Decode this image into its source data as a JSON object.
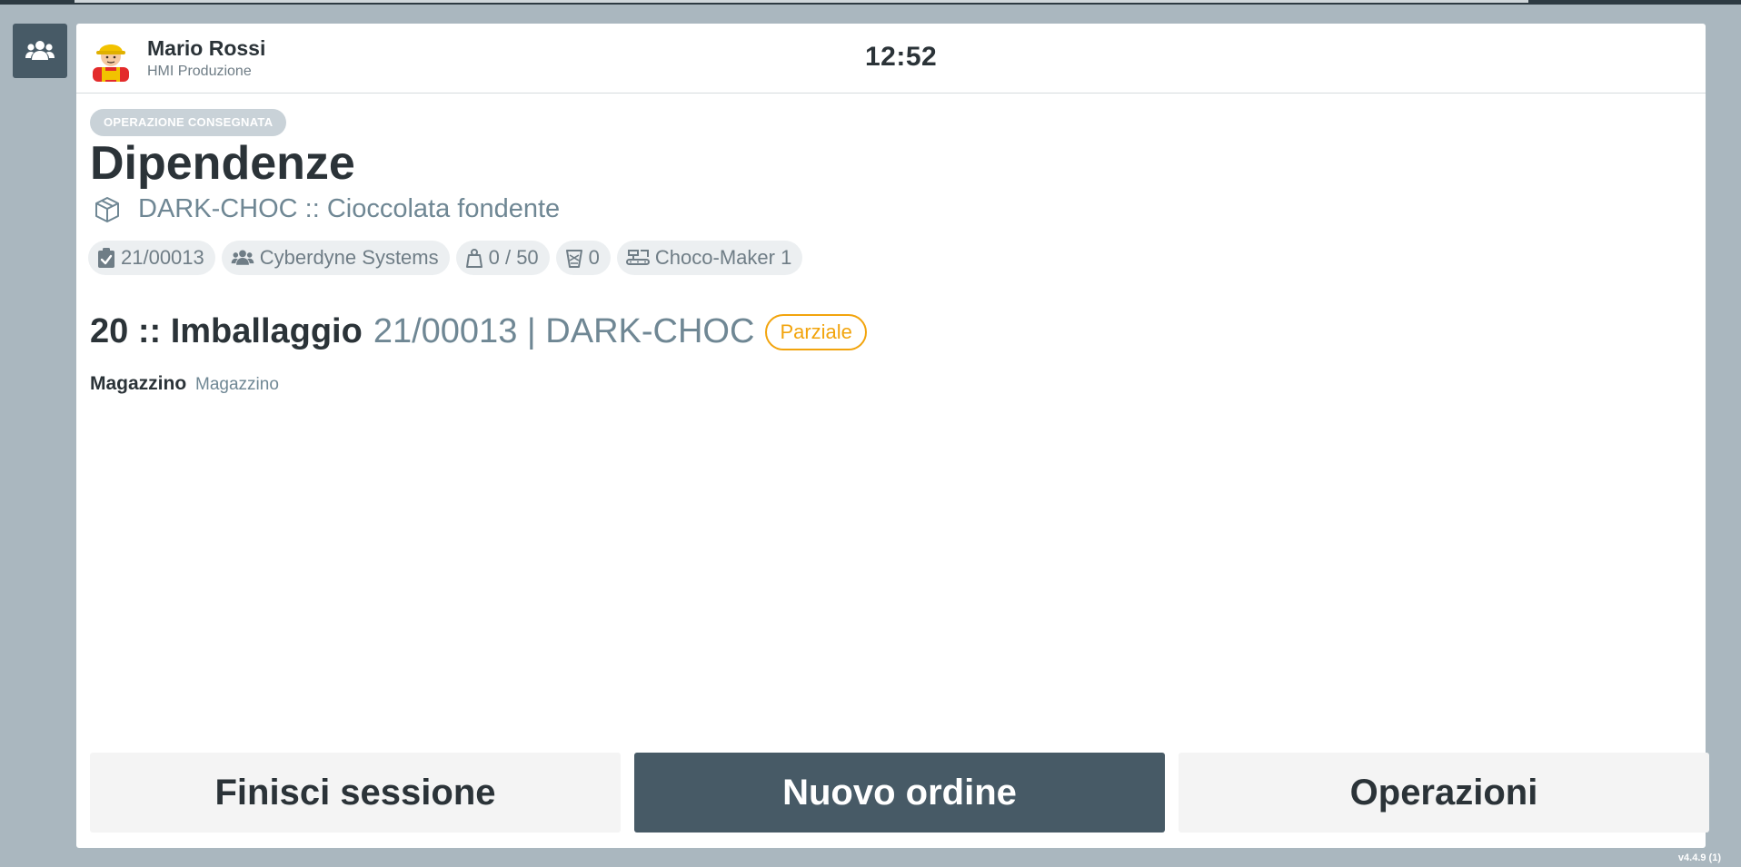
{
  "sidebar": {
    "icon": "users-icon"
  },
  "user": {
    "name": "Mario Rossi",
    "role": "HMI Produzione",
    "avatar_icon": "worker-avatar-icon"
  },
  "clock": "12:52",
  "status": "OPERAZIONE CONSEGNATA",
  "title": "Dipendenze",
  "product": {
    "icon": "box-icon",
    "label": "DARK-CHOC :: Cioccolata fondente"
  },
  "chips": {
    "order": {
      "icon": "clipboard-check-icon",
      "label": "21/00013"
    },
    "customer": {
      "icon": "users-icon",
      "label": "Cyberdyne Systems"
    },
    "quantity": {
      "icon": "weight-icon",
      "label": "0 / 50"
    },
    "waste": {
      "icon": "trash-icon",
      "label": "0"
    },
    "machine": {
      "icon": "machine-icon",
      "label": "Choco-Maker 1"
    }
  },
  "operation": {
    "title": "20 :: Imballaggio",
    "subtitle": "21/00013 | DARK-CHOC",
    "badge": "Parziale",
    "badge_color": "#f2a40d"
  },
  "warehouse": {
    "label": "Magazzino",
    "value": "Magazzino"
  },
  "actions": {
    "end_session": "Finisci sessione",
    "new_order": "Nuovo ordine",
    "operations": "Operazioni"
  },
  "version": "v4.4.9 (1)",
  "colors": {
    "primary": "#475a66",
    "accent": "#f2a40d",
    "background": "#aab7bf"
  }
}
